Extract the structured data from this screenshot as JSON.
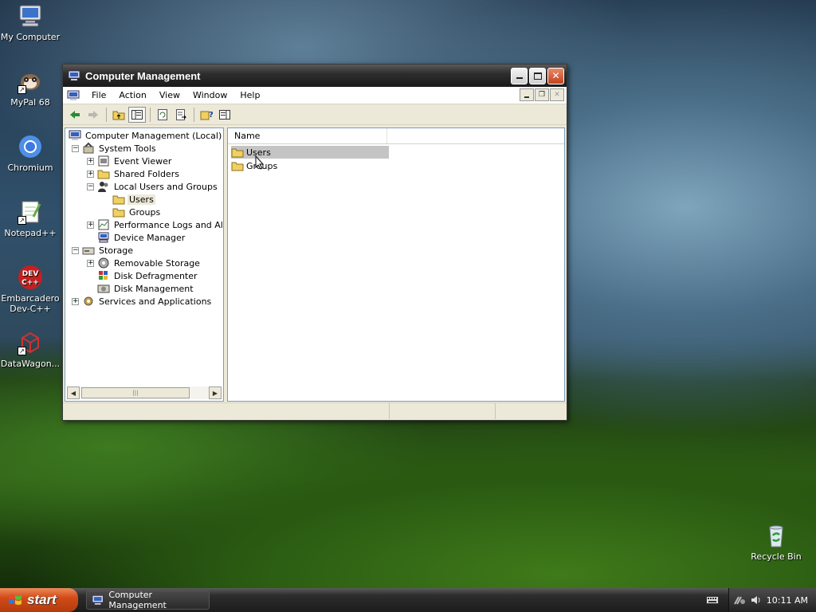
{
  "desktop": {
    "icons": [
      {
        "label": "My Computer",
        "icon": "computer-icon"
      },
      {
        "label": "MyPal 68",
        "icon": "mypal-icon"
      },
      {
        "label": "Chromium",
        "icon": "chromium-icon"
      },
      {
        "label": "Notepad++",
        "icon": "notepadpp-icon"
      },
      {
        "label": "Embarcadero Dev-C++",
        "icon": "devcpp-icon"
      },
      {
        "label": "DataWagon...",
        "icon": "datawagon-icon"
      }
    ],
    "recycle_bin": {
      "label": "Recycle Bin",
      "icon": "recycle-bin-icon"
    }
  },
  "window": {
    "title": "Computer Management",
    "menu": [
      "File",
      "Action",
      "View",
      "Window",
      "Help"
    ],
    "tree": [
      {
        "label": "Computer Management (Local)",
        "icon": "computer-management-icon"
      },
      {
        "label": "System Tools",
        "icon": "tools-icon",
        "expander": "−"
      },
      {
        "label": "Event Viewer",
        "icon": "event-viewer-icon",
        "expander": "+"
      },
      {
        "label": "Shared Folders",
        "icon": "shared-folder-icon",
        "expander": "+"
      },
      {
        "label": "Local Users and Groups",
        "icon": "users-groups-icon",
        "expander": "−"
      },
      {
        "label": "Users",
        "icon": "folder-icon",
        "selected": true
      },
      {
        "label": "Groups",
        "icon": "folder-icon"
      },
      {
        "label": "Performance Logs and Alerts",
        "icon": "performance-icon",
        "expander": "+"
      },
      {
        "label": "Device Manager",
        "icon": "device-manager-icon"
      },
      {
        "label": "Storage",
        "icon": "storage-icon",
        "expander": "−"
      },
      {
        "label": "Removable Storage",
        "icon": "removable-storage-icon",
        "expander": "+"
      },
      {
        "label": "Disk Defragmenter",
        "icon": "defrag-icon"
      },
      {
        "label": "Disk Management",
        "icon": "disk-management-icon"
      },
      {
        "label": "Services and Applications",
        "icon": "services-icon",
        "expander": "+"
      }
    ],
    "list": {
      "columns": [
        "Name"
      ],
      "rows": [
        {
          "name": "Users",
          "icon": "folder-icon",
          "selected": true
        },
        {
          "name": "Groups",
          "icon": "folder-icon"
        }
      ]
    }
  },
  "taskbar": {
    "start_label": "start",
    "task_label": "Computer Management",
    "clock": "10:11 AM"
  },
  "colors": {
    "titlebar": "#2e2e2e",
    "start_button": "#d24b19",
    "window_face": "#ece9d8",
    "selection": "#c4c4c4"
  }
}
